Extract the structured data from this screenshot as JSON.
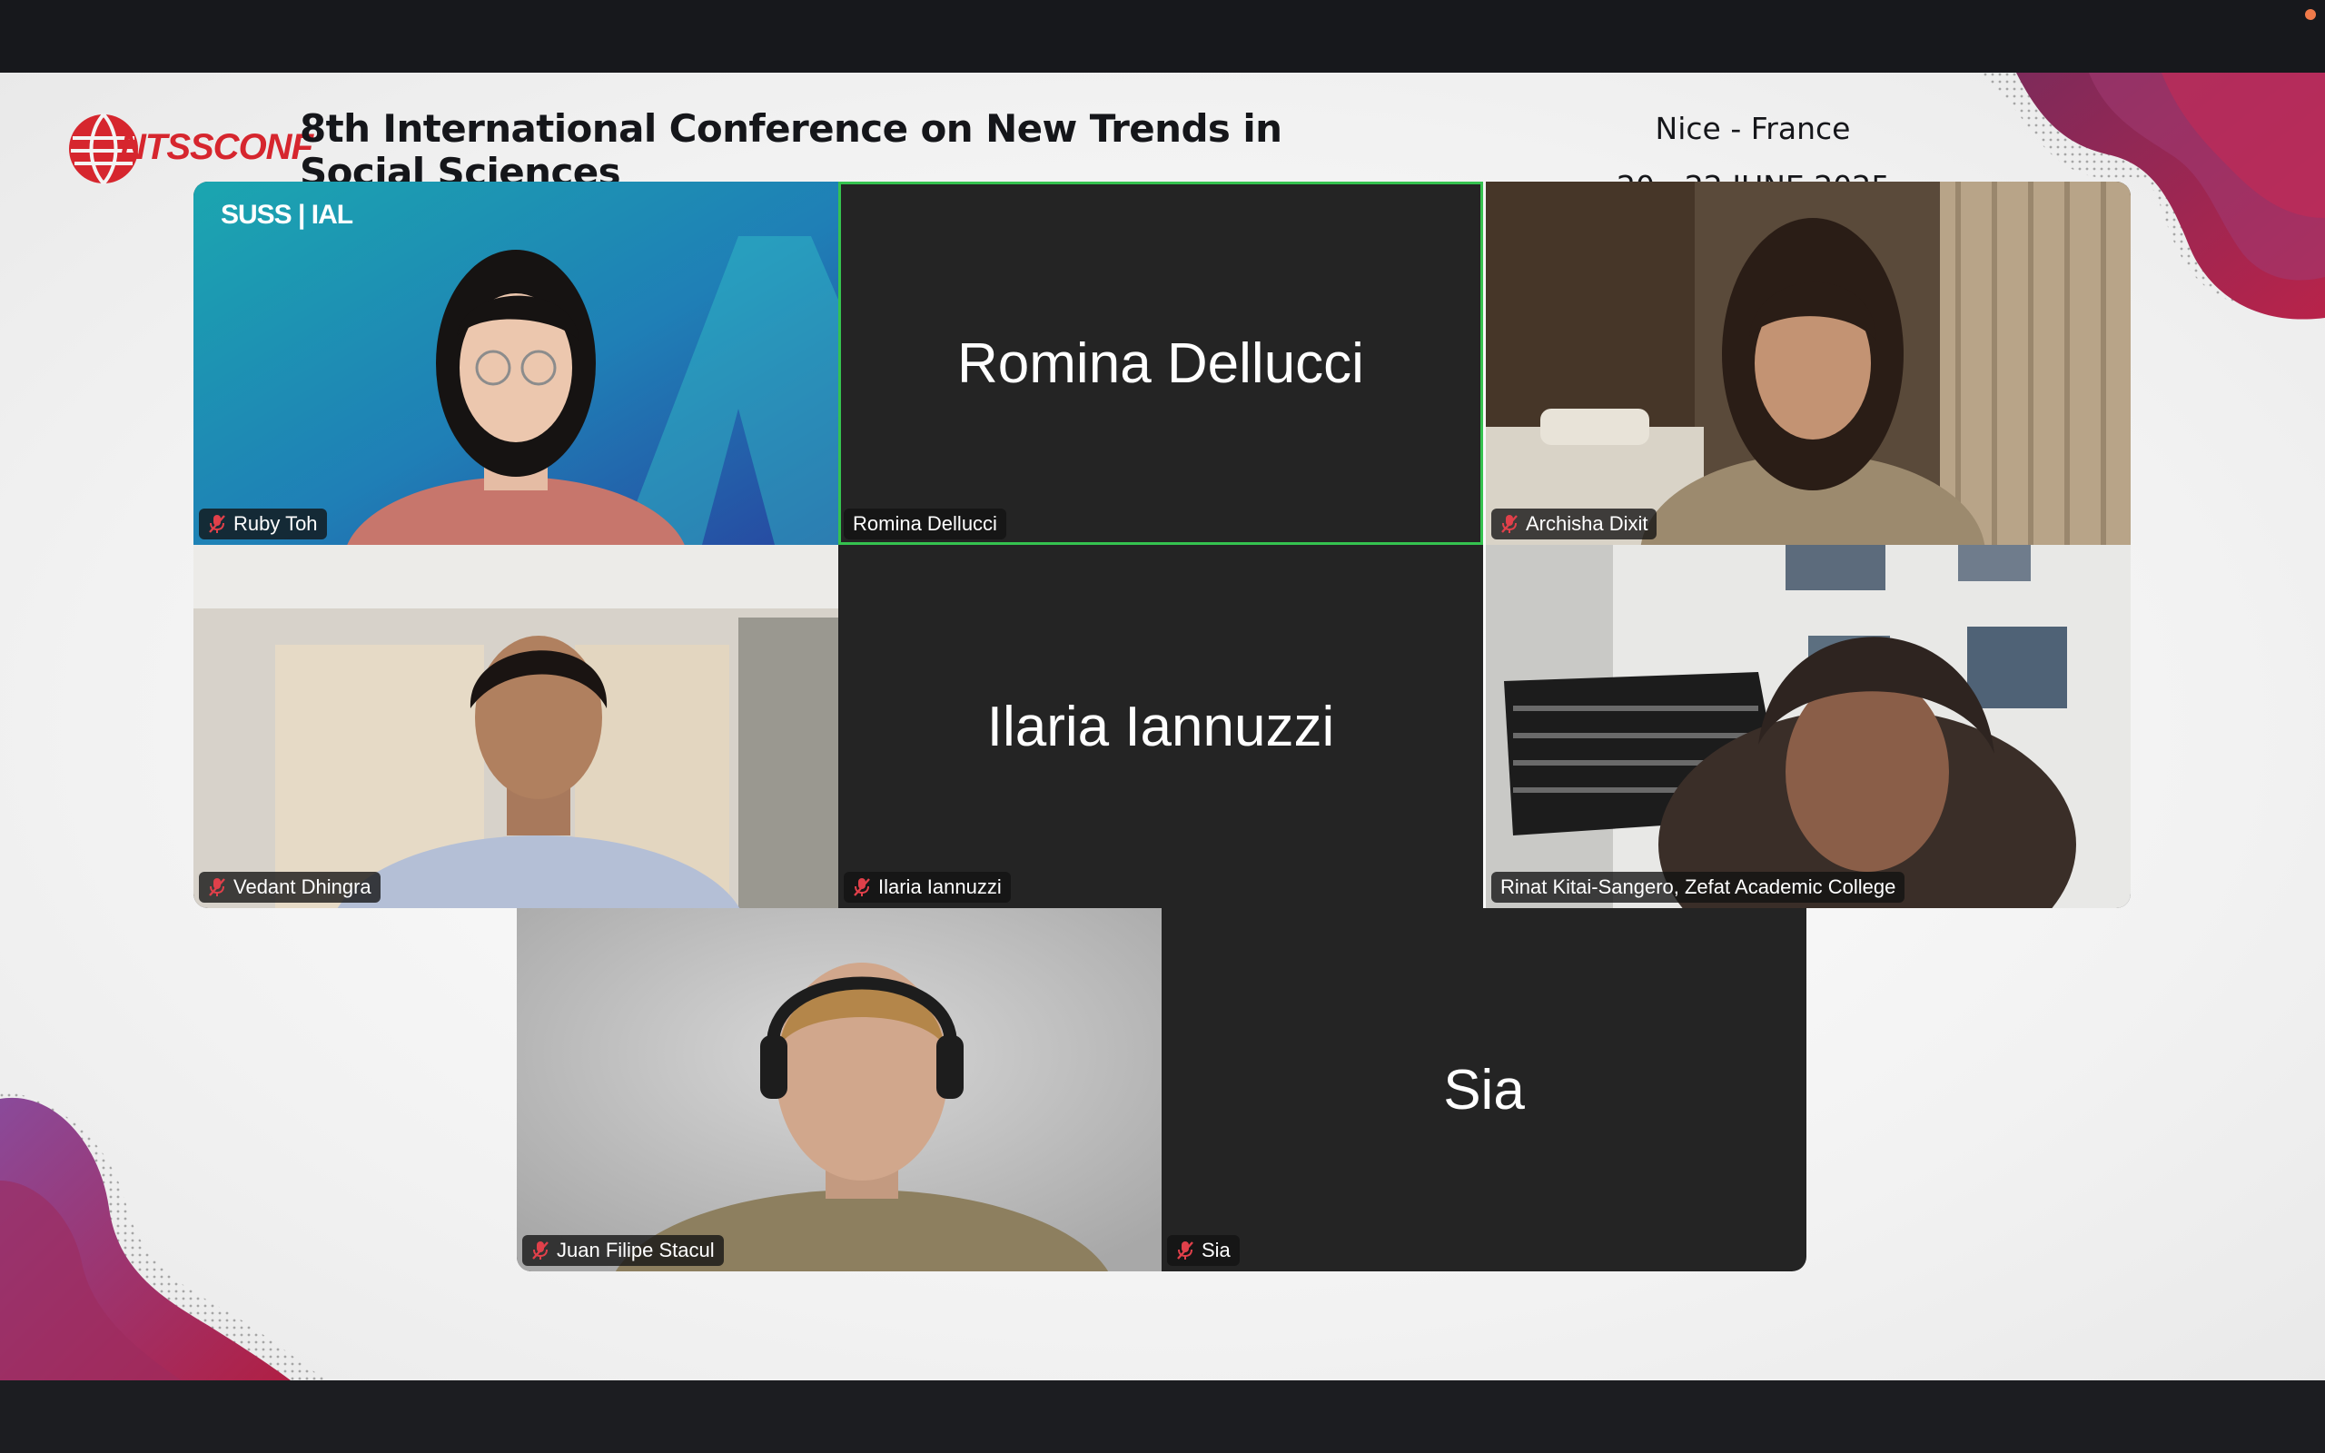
{
  "conference": {
    "logo_text": "NTSSCONF",
    "title": "8th International Conference on New Trends in Social Sciences",
    "location": "Nice - France",
    "dates": "20 - 22 JUNE 2025"
  },
  "ruby_tile_logo": "SUSS | IAL",
  "colors": {
    "active_speaker_border": "#35c24f",
    "muted_icon": "#e0404a",
    "tile_background": "#242424",
    "brand_red": "#d6262e",
    "wave_magenta": "#9e2348"
  },
  "participants": [
    {
      "name": "Ruby Toh",
      "muted": true,
      "video": true
    },
    {
      "name": "Romina Dellucci",
      "muted": false,
      "video": false,
      "active_speaker": true
    },
    {
      "name": "Archisha Dixit",
      "muted": true,
      "video": true
    },
    {
      "name": "Vedant Dhingra",
      "muted": true,
      "video": true
    },
    {
      "name": "Ilaria Iannuzzi",
      "muted": true,
      "video": false
    },
    {
      "name": "Rinat Kitai-Sangero, Zefat Academic College",
      "muted": false,
      "video": true
    },
    {
      "name": "Juan Filipe Stacul",
      "muted": true,
      "video": true
    },
    {
      "name": "Sia",
      "muted": true,
      "video": false
    }
  ]
}
